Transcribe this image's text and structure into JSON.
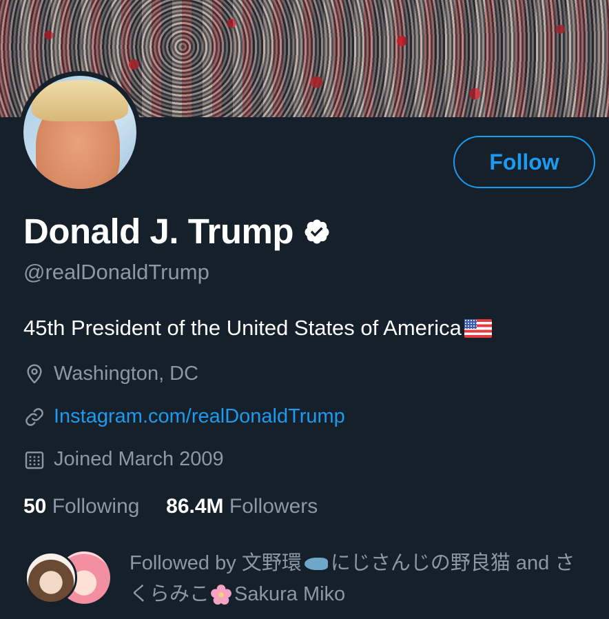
{
  "profile": {
    "name": "Donald J. Trump",
    "handle": "@realDonaldTrump",
    "bio": "45th President of the United States of America",
    "location": "Washington, DC",
    "website": "Instagram.com/realDonaldTrump",
    "joined": "Joined March 2009",
    "verified": true
  },
  "actions": {
    "follow_label": "Follow"
  },
  "stats": {
    "following_count": "50",
    "following_label": "Following",
    "followers_count": "86.4M",
    "followers_label": "Followers"
  },
  "followed_by": {
    "prefix": "Followed by ",
    "user1": "文野環",
    "user2": "にじさんじの野良猫",
    "joiner": " and ",
    "user3_pre": "さくらみこ",
    "user3_post": "Sakura Miko"
  },
  "icons": {
    "location": "location-pin-icon",
    "website": "link-icon",
    "joined": "calendar-icon",
    "verified": "verified-badge-icon"
  },
  "colors": {
    "background": "#15202b",
    "accent": "#1d9bf0",
    "muted": "#8b98a5",
    "text": "#ffffff"
  }
}
